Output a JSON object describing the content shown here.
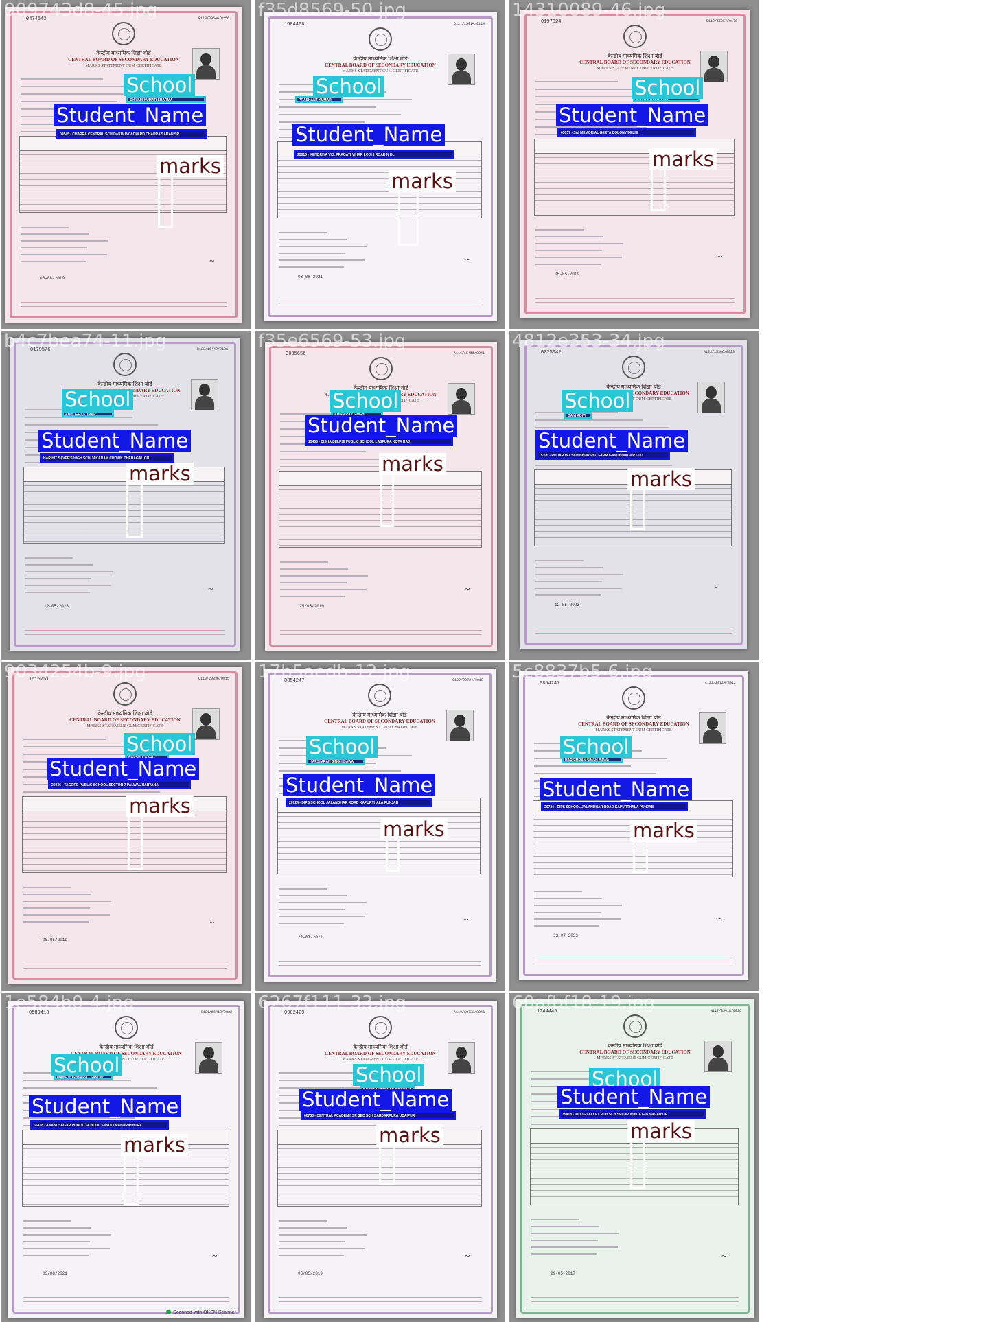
{
  "tiles": [
    {
      "filename": "909743d8-45.jpg",
      "serial": "0474643",
      "reg_no": "P119/09546/0256",
      "board_hi": "केन्द्रीय माध्यमिक शिक्षा बोर्ड",
      "board_en": "CENTRAL BOARD OF SECONDARY EDUCATION",
      "cert": "MARKS STATEMENT CUM CERTIFICATE",
      "student_field": "SHIVAM KUMAR SHARMA",
      "school_field": "09545 - CHAPRA CENTRAL SCH DAKBUNGLOW RD CHAPRA SARAN SR",
      "labels": {
        "school": "School",
        "student": "Student_Name",
        "marks": "marks"
      },
      "date": "06-08-2019",
      "tone": "pink"
    },
    {
      "filename": "f35d8569-50.jpg",
      "serial": "1684408",
      "reg_no": "D121/25014/0114",
      "board_hi": "केन्द्रीय माध्यमिक शिक्षा बोर्ड",
      "board_en": "CENTRAL BOARD OF SECONDARY EDUCATION",
      "cert": "MARKS STATEMENT CUM CERTIFICATE",
      "student_field": "PRASHANT KUMAR",
      "school_field": "25016 - KENDRIYA VID. PRAGATI VIHAR LODHI ROAD N DL",
      "labels": {
        "school": "School",
        "student": "Student_Name",
        "marks": "marks"
      },
      "date": "03-08-2021",
      "tone": "plain"
    },
    {
      "filename": "14310089-46.jpg",
      "serial": "0197824",
      "reg_no": "D119/55057/0176",
      "board_hi": "केन्द्रीय माध्यमिक शिक्षा बोर्ड",
      "board_en": "CENTRAL BOARD OF SECONDARY EDUCATION",
      "cert": "MARKS STATEMENT CUM CERTIFICATE",
      "student_field": "SATVICKA SHARMA",
      "school_field": "65057 - SAI MEMORIAL GEETA COLONY DELHI",
      "labels": {
        "school": "School",
        "student": "Student_Name",
        "marks": "marks"
      },
      "date": "06-05-2019",
      "tone": "pink"
    },
    {
      "filename": "b4c7bea74-11.jpg",
      "serial": "0179576",
      "reg_no": "B123/16449/0106",
      "board_hi": "केन्द्रीय माध्यमिक शिक्षा बोर्ड",
      "board_en": "CENTRAL BOARD OF SECONDARY EDUCATION",
      "cert": "MARKS STATEMENT CUM CERTIFICATE",
      "student_field": "ABHIJEET KUMAR",
      "school_field": "HARIHIT SAVEE'S HIGH SCH JAKANAM CHOWK DHEHAGAL CH",
      "labels": {
        "school": "School",
        "student": "Student_Name",
        "marks": "marks"
      },
      "date": "12-05-2023",
      "tone": "grey"
    },
    {
      "filename": "f35e6569-53.jpg",
      "serial": "0035656",
      "reg_no": "A116/15455/0041",
      "board_hi": "केन्द्रीय माध्यमिक शिक्षा बोर्ड",
      "board_en": "CENTRAL BOARD OF SECONDARY EDUCATION",
      "cert": "MARKS STATEMENT CUM CERTIFICATE",
      "student_field": "AMAN RAJ SINGH",
      "school_field": "15455 - DISHA DELPHI PUBLIC SCHOOL LASPURA KOTA RAJ",
      "labels": {
        "school": "School",
        "student": "Student_Name",
        "marks": "marks"
      },
      "date": "25/05/2019",
      "tone": "pink"
    },
    {
      "filename": "4812e353-34.jpg",
      "serial": "0025042",
      "reg_no": "A123/15306/0023",
      "board_hi": "केन्द्रीय माध्यमिक शिक्षा बोर्ड",
      "board_en": "CENTRAL BOARD OF SECONDARY EDUCATION",
      "cert": "MARKS STATEMENT CUM CERTIFICATE",
      "student_field": "DANI ADITI",
      "school_field": "15306 - PODAR INT SCH BHURSHTI FARM GANDHINAGAR GUJ",
      "labels": {
        "school": "School",
        "student": "Student_Name",
        "marks": "marks"
      },
      "date": "12-05-2023",
      "tone": "grey"
    },
    {
      "filename": "9034254b-9.jpg",
      "serial": "1515751",
      "reg_no": "C119/20336/0015",
      "board_hi": "केन्द्रीय माध्यमिक शिक्षा बोर्ड",
      "board_en": "CENTRAL BOARD OF SECONDARY EDUCATION",
      "cert": "MARKS STATEMENT CUM CERTIFICATE",
      "student_field": "HARSHIT GARG",
      "school_field": "20336 - TAGORE PUBLIC SCHOOL SECTOR 7 PALWAL HARYANA",
      "labels": {
        "school": "School",
        "student": "Student_Name",
        "marks": "marks"
      },
      "date": "06/05/2019",
      "tone": "pink"
    },
    {
      "filename": "17b5aedb-12.jpg",
      "serial": "0854247",
      "reg_no": "C122/20724/0012",
      "board_hi": "केन्द्रीय माध्यमिक शिक्षा बोर्ड",
      "board_en": "CENTRAL BOARD OF SECONDARY EDUCATION",
      "cert": "MARKS STATEMENT CUM CERTIFICATE",
      "student_field": "HARSIMRAN SINGH BAWA",
      "school_field": "20724 - DIPS SCHOOL JALANDHAR ROAD KAPURTHALA PUNJAB",
      "labels": {
        "school": "School",
        "student": "Student_Name",
        "marks": "marks"
      },
      "date": "22-07-2022",
      "tone": "plain"
    },
    {
      "filename": "5c8837b5-6.jpg",
      "serial": "0854247",
      "reg_no": "C122/20724/0012",
      "board_hi": "केन्द्रीय माध्यमिक शिक्षा बोर्ड",
      "board_en": "CENTRAL BOARD OF SECONDARY EDUCATION",
      "cert": "MARKS STATEMENT CUM CERTIFICATE",
      "student_field": "HARSIMRAN SINGH BAWA",
      "school_field": "20724 - DIPS SCHOOL JALANDHAR ROAD KAPURTHALA PUNJAB",
      "labels": {
        "school": "School",
        "student": "Student_Name",
        "marks": "marks"
      },
      "date": "22-07-2022",
      "tone": "plain"
    },
    {
      "filename": "1e584b0-4.jpg",
      "serial": "0589413",
      "reg_no": "E121/56418/0033",
      "board_hi": "केन्द्रीय माध्यमिक शिक्षा बोर्ड",
      "board_en": "CENTRAL BOARD OF SECONDARY EDUCATION",
      "cert": "MARKS STATEMENT CUM CERTIFICATE",
      "student_field": "MANE PUSHKARAJ SANDIP",
      "school_field": "56418 - ANANDSAGAR PUBLIC SCHOOL SANDLI MAHARASHTRA",
      "labels": {
        "school": "School",
        "student": "Student_Name",
        "marks": "marks"
      },
      "date": "03/08/2021",
      "tone": "plain",
      "scanner": "Scanned with OKEN Scanner"
    },
    {
      "filename": "6267f111-33.jpg",
      "serial": "0902429",
      "reg_no": "A119/60733/0045",
      "board_hi": "केन्द्रीय माध्यमिक शिक्षा बोर्ड",
      "board_en": "CENTRAL BOARD OF SECONDARY EDUCATION",
      "cert": "MARKS STATEMENT CUM CERTIFICATE",
      "student_field": "POOJA KUMAWAR GROHIHAN",
      "school_field": "60733 - CENTRAL ACADEMY SR SEC SCH SARDARPURA UDAIPUR",
      "labels": {
        "school": "School",
        "student": "Student_Name",
        "marks": "marks"
      },
      "date": "06/05/2019",
      "tone": "plain"
    },
    {
      "filename": "60afbf18-19.jpg",
      "serial": "1244445",
      "reg_no": "N117/35418/0026",
      "board_hi": "केन्द्रीय माध्यमिक शिक्षा बोर्ड",
      "board_en": "CENTRAL BOARD OF SECONDARY EDUCATION",
      "cert": "MARKS STATEMENT CUM CERTIFICATE",
      "student_field": "35418 - INDUS VALLEY PUB SCH SEC-62 NOIDA G B NAGAR UP",
      "school_field": "35418 - INDUS VALLEY PUB SCH SEC-62 NOIDA G B NAGAR UP",
      "labels": {
        "school": "School",
        "student": "Student_Name",
        "marks": "marks"
      },
      "date": "29-05-2017",
      "tone": "green"
    }
  ]
}
